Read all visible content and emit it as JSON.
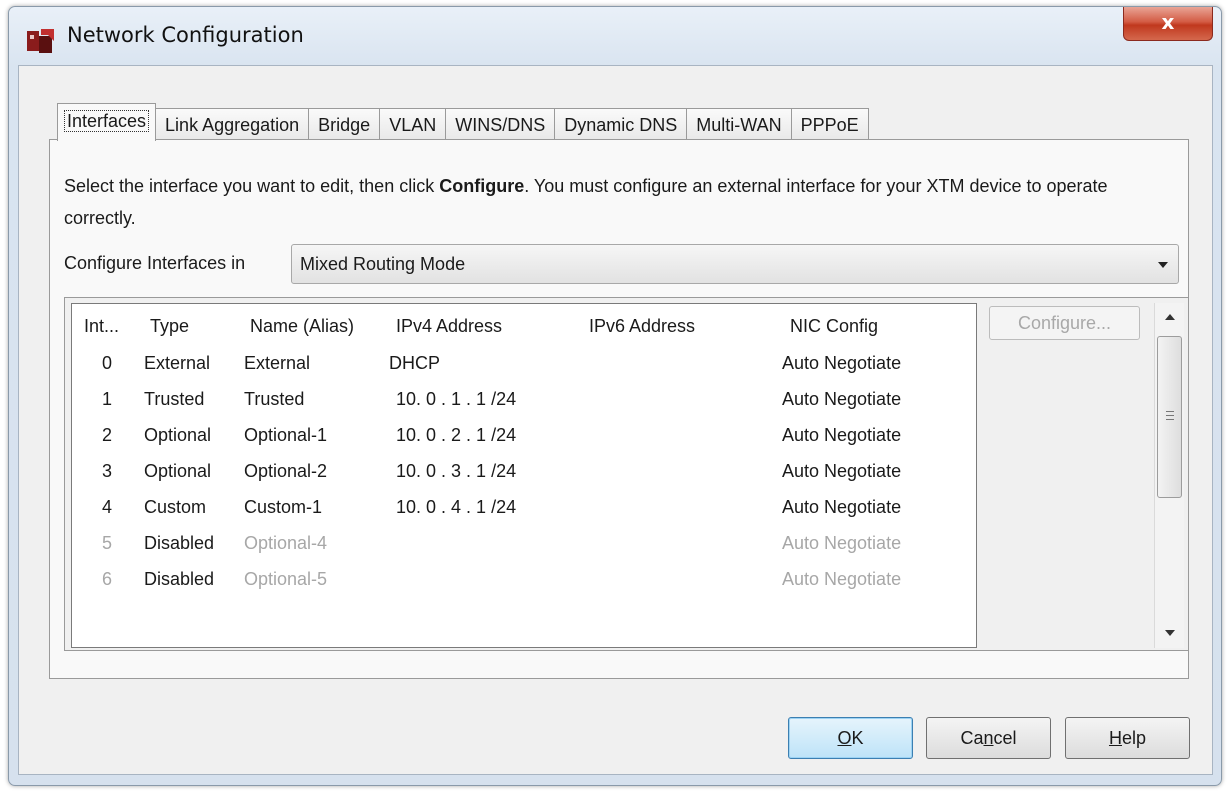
{
  "window": {
    "title": "Network Configuration",
    "close_glyph": "x",
    "icon": "watchguard-logo-icon"
  },
  "tabs": [
    {
      "label": "Interfaces",
      "active": true
    },
    {
      "label": "Link Aggregation",
      "active": false
    },
    {
      "label": "Bridge",
      "active": false
    },
    {
      "label": "VLAN",
      "active": false
    },
    {
      "label": "WINS/DNS",
      "active": false
    },
    {
      "label": "Dynamic DNS",
      "active": false
    },
    {
      "label": "Multi-WAN",
      "active": false
    },
    {
      "label": "PPPoE",
      "active": false
    }
  ],
  "description": {
    "part1": "Select the interface you want to edit, then click ",
    "bold": "Configure",
    "part2": ". You must configure an external interface for your XTM device to operate correctly."
  },
  "configure_in": {
    "label": "Configure Interfaces in",
    "selected": "Mixed Routing Mode"
  },
  "table": {
    "headers": [
      "Int...",
      "Type",
      "Name (Alias)",
      "IPv4 Address",
      "IPv6 Address",
      "NIC Config"
    ],
    "rows": [
      {
        "num": "0",
        "type": "External",
        "name": "External",
        "ipv4": "DHCP",
        "ipv6": "",
        "nic": "Auto Negotiate",
        "disabled": false
      },
      {
        "num": "1",
        "type": "Trusted",
        "name": "Trusted",
        "ipv4": "10. 0 . 1 . 1 /24",
        "ipv6": "",
        "nic": "Auto Negotiate",
        "disabled": false
      },
      {
        "num": "2",
        "type": "Optional",
        "name": "Optional-1",
        "ipv4": "10. 0 . 2 . 1 /24",
        "ipv6": "",
        "nic": "Auto Negotiate",
        "disabled": false
      },
      {
        "num": "3",
        "type": "Optional",
        "name": "Optional-2",
        "ipv4": "10. 0 . 3 . 1 /24",
        "ipv6": "",
        "nic": "Auto Negotiate",
        "disabled": false
      },
      {
        "num": "4",
        "type": "Custom",
        "name": "Custom-1",
        "ipv4": "10. 0 . 4 . 1 /24",
        "ipv6": "",
        "nic": "Auto Negotiate",
        "disabled": false
      },
      {
        "num": "5",
        "type": "Disabled",
        "name": "Optional-4",
        "ipv4": "",
        "ipv6": "",
        "nic": "Auto Negotiate",
        "disabled": true
      },
      {
        "num": "6",
        "type": "Disabled",
        "name": "Optional-5",
        "ipv4": "",
        "ipv6": "",
        "nic": "Auto Negotiate",
        "disabled": true
      }
    ]
  },
  "configure_button": "Configure...",
  "buttons": {
    "ok": {
      "mnemonic": "O",
      "rest": "K"
    },
    "cancel": {
      "pre": "Ca",
      "mnemonic": "n",
      "post": "cel"
    },
    "help": {
      "mnemonic": "H",
      "rest": "elp"
    }
  }
}
